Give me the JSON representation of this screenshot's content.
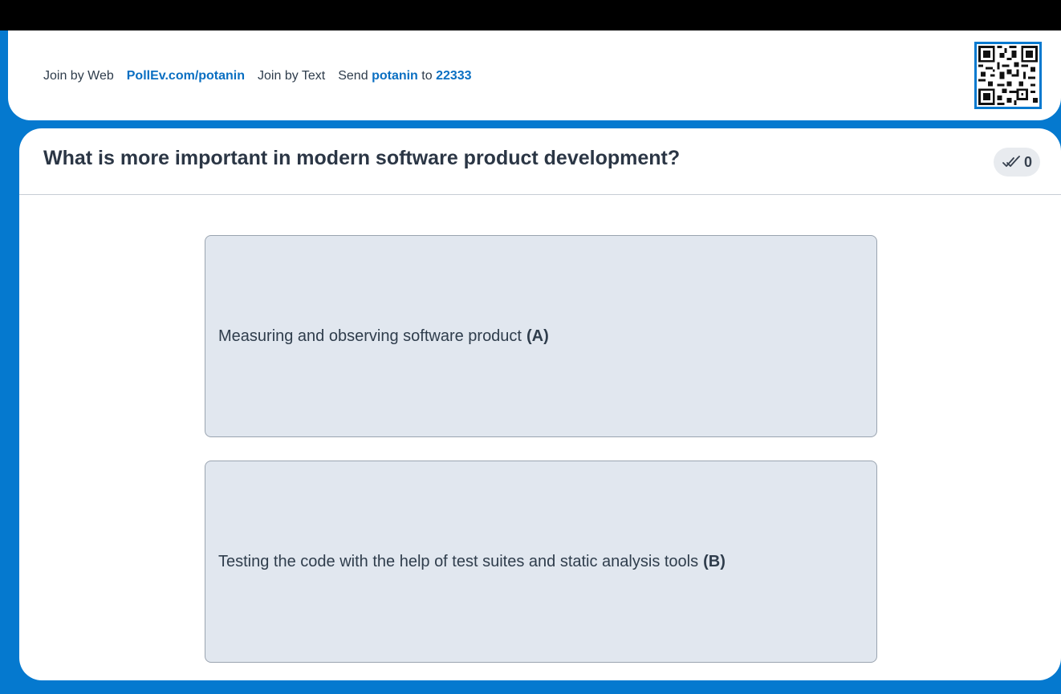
{
  "join": {
    "web_label": "Join by Web",
    "web_url": "PollEv.com/potanin",
    "text_label": "Join by Text",
    "send_label": "Send",
    "keyword": "potanin",
    "to_label": "to",
    "number": "22333"
  },
  "poll": {
    "question": "What is more important in modern software product development?",
    "response_count": "0",
    "options": [
      {
        "text": "Measuring and observing software product",
        "letter": "(A)"
      },
      {
        "text": "Testing the code with the help of test suites and static analysis tools",
        "letter": "(B)"
      }
    ]
  },
  "icons": {
    "qr": "qr-code-icon",
    "responses": "responses-check-icon"
  },
  "colors": {
    "brand_blue": "#0579cf",
    "link_blue": "#0a6fc2",
    "option_fill": "#e1e7ef",
    "option_border": "#9aa4b0",
    "text_dark": "#2f3d4c"
  }
}
